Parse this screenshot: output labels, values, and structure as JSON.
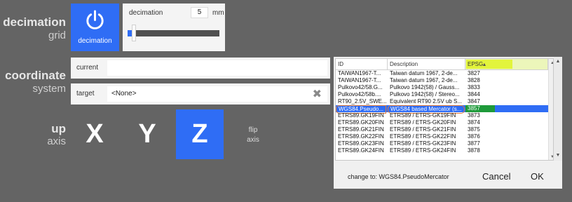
{
  "decimation": {
    "title": "decimation",
    "subtitle": "grid",
    "button_label": "decimation",
    "panel_title": "decimation",
    "value": "5",
    "unit": "mm",
    "slider_level": 0.05,
    "power_icon": "power-icon"
  },
  "coordinate": {
    "title": "coordinate",
    "subtitle": "system",
    "current_label": "current",
    "current_value": "",
    "target_label": "target",
    "target_value": "<None>",
    "clear_icon": "close-icon"
  },
  "up_axis": {
    "title": "up",
    "subtitle": "axis",
    "buttons": [
      "X",
      "Y",
      "Z"
    ],
    "active": "Z",
    "flip_label": "flip",
    "flip_sub": "axis"
  },
  "dialog": {
    "columns": [
      "ID",
      "Description",
      "EPSG"
    ],
    "sort_icon": "sort-up-icon",
    "rows": [
      {
        "id": "TAIWAN1967-T...",
        "desc": "Taiwan datum 1967, 2-de...",
        "epsg": "3827"
      },
      {
        "id": "TAIWAN1967-T...",
        "desc": "Taiwan datum 1967, 2-de...",
        "epsg": "3828"
      },
      {
        "id": "Pulkovo42/58.G...",
        "desc": "Pulkovo 1942(58) / Gauss...",
        "epsg": "3833"
      },
      {
        "id": "Pulkovo42/58b....",
        "desc": "Pulkovo 1942(58) / Stereo...",
        "epsg": "3844"
      },
      {
        "id": "RT90_2.5V_SWE...",
        "desc": "Equivalent RT90 2.5V ub S...",
        "epsg": "3847"
      },
      {
        "id": "WGS84.Pseudo...",
        "desc": "WGS84 based Mercator (s...",
        "epsg": "3857"
      },
      {
        "id": "ETRS89.GK19FIN",
        "desc": "ETRS89 / ETRS-GK19FIN",
        "epsg": "3873"
      },
      {
        "id": "ETRS89.GK20FIN",
        "desc": "ETRS89 / ETRS-GK20FIN",
        "epsg": "3874"
      },
      {
        "id": "ETRS89.GK21FIN",
        "desc": "ETRS89 / ETRS-GK21FIN",
        "epsg": "3875"
      },
      {
        "id": "ETRS89.GK22FIN",
        "desc": "ETRS89 / ETRS-GK22FIN",
        "epsg": "3876"
      },
      {
        "id": "ETRS89.GK23FIN",
        "desc": "ETRS89 / ETRS-GK23FIN",
        "epsg": "3877"
      },
      {
        "id": "ETRS89.GK24FIN",
        "desc": "ETRS89 / ETRS-GK24FIN",
        "epsg": "3878"
      }
    ],
    "selected_index": 5,
    "change_to": "change to: WGS84.PseudoMercator",
    "cancel_label": "Cancel",
    "ok_label": "OK"
  },
  "colors": {
    "background": "#646464",
    "accent": "#2f6df5",
    "epsg_highlight": "#e2f43c",
    "selection_outline": "#e07a3a"
  }
}
